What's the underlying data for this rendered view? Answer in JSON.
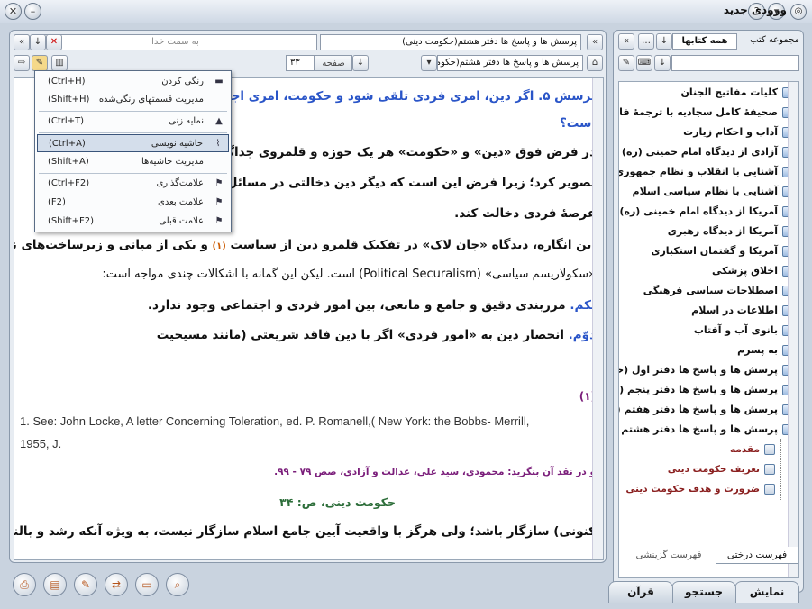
{
  "window": {
    "title": "ورودی جدید"
  },
  "reader": {
    "back_field": "به سمت خدا",
    "doc_title": "پرسش ها و پاسخ ها دفتر هشتم(حکومت دینی)",
    "page_label": "صفحه",
    "page_value": "٣٣",
    "book_select": "پرسش ها و پاسخ ها دفتر هشتم(حکومـ..."
  },
  "menu": {
    "items": [
      {
        "label": "رنگی کردن",
        "shortcut": "(Ctrl+H)"
      },
      {
        "label": "مدیریت قسمتهای رنگی‌شده",
        "shortcut": "(Shift+H)"
      },
      {
        "label": "نمایه زنی",
        "shortcut": "(Ctrl+T)"
      },
      {
        "label": "حاشیه نویسی",
        "shortcut": "(Ctrl+A)"
      },
      {
        "label": "مدیریت حاشیه‌ها",
        "shortcut": "(Shift+A)"
      },
      {
        "label": "علامت‌گذاری",
        "shortcut": "(Ctrl+F2)"
      },
      {
        "label": "علامت بعدی",
        "shortcut": "(F2)"
      },
      {
        "label": "علامت قبلی",
        "shortcut": "(Shift+F2)"
      }
    ]
  },
  "content": {
    "q1": "پرسش ۵. اگر دین، امری فردی تلقی شود و حکومت، امری اجتماعی، ...",
    "q2": "است؟",
    "l1": "در فرض فوق «دین» و «حکومت» هر یک حوزه و قلمروی جداگانه دارند ... را",
    "l2": "تصویر کرد؛ زیرا فرض این است که دیگر دین دخالتی در مسائل ... در",
    "l3": "عرصهٔ فردی دخالت کند.",
    "l4": "این انگاره، دیدگاه «جان لاک» در تفکیک قلمرو دین از سیاست",
    "l4ref": "(١)",
    "l4b": "و یکی از مبانی و زیرساخت‌های نظری",
    "l5": "«سکولاریسم سیاسی» (Political Securalism) است. لیکن این گمانه با اشکالات چندی مواجه است:",
    "l6a": "یکم.",
    "l6b": "مرزبندی دقیق و جامع و مانعی، بین امور فردی و اجتماعی وجود ندارد.",
    "l7a": "دوّم.",
    "l7b": "انحصار دین به «امور فردی» اگر با دین فاقد شریعتی (مانند مسیحیت",
    "fn_num": "(١)",
    "fn1": "1. See: John Locke, A letter Concerning Toleration, ed. P. Romanell,( New York: the Bobbs- Merrill,",
    "fn2": "1955, J.",
    "fn3": "و در نقد آن بنگرید: محمودی، سید علی، عدالت و آزادی، صص ٧٩ - ٩٩.",
    "page_head": "حکومت دینی، ص: ٣۴",
    "l8": "کنونی) سازگار باشد؛ ولی هرگز با واقعیت آیین جامع اسلام سازگار نیست، به ویژه آنکه رشد و بالندگی"
  },
  "side": {
    "collection_label": "مجموعه کتب",
    "collection_value": "همه کتابها",
    "tree": [
      "کلیات مفاتیح الجنان",
      "صحیفهٔ کامل سجادیه با ترجمهٔ فارسی",
      "آداب و احکام زیارت",
      "آزادی از دیدگاه امام خمینی (ره)",
      "آشنایی با انقلاب و نظام جمهوری اسلامی",
      "آشنایی با نظام سیاسی اسلام",
      "آمریکا از دیدگاه امام خمینی (ره)",
      "آمریکا از دیدگاه رهبری",
      "آمریکا و گفتمان استکباری",
      "اخلاق پزشکی",
      "اصطلاحات سیاسی فرهنگی",
      "اطلاعات در اسلام",
      "بانوی آب و آفتاب",
      "به پسرم",
      "پرسش ها و پاسخ ها دفتر اول (خداشناسی)",
      "پرسش ها و پاسخ ها دفتر پنجم (قرآن)",
      "پرسش ها و پاسخ ها دفتر هفتم (پرسش ...)",
      "پرسش ها و پاسخ ها دفتر هشتم (حکومت دینی)"
    ],
    "subitems": [
      "مقدمه",
      "تعریف حکومت دینی",
      "ضرورت و هدف حکومت دینی"
    ],
    "tab_tree": "فهرست درختی",
    "tab_select": "فهرست گزینشی"
  },
  "bottom_tabs": [
    "نمایش",
    "جستجو",
    "قرآن"
  ]
}
